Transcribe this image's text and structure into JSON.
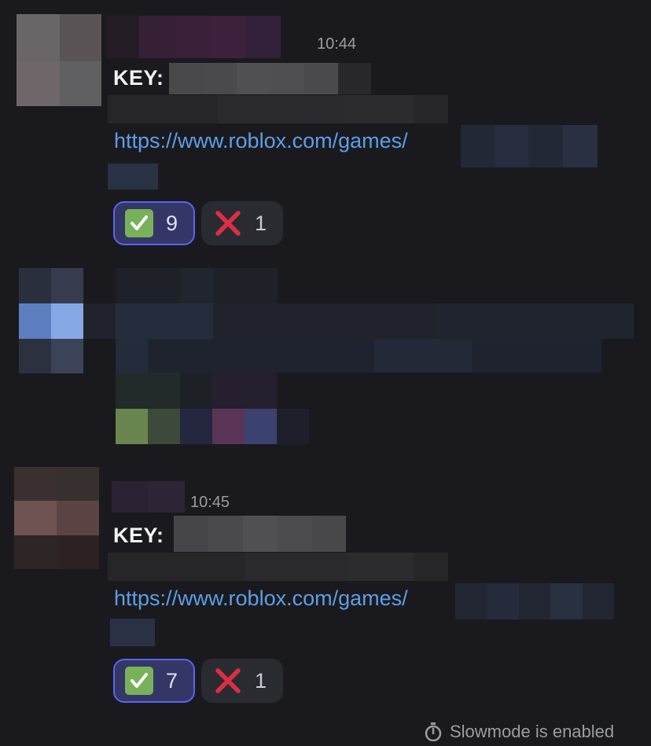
{
  "messages": [
    {
      "timestamp": "10:44",
      "key_label": "KEY:",
      "link_text": "https://www.roblox.com/games/",
      "reactions": [
        {
          "emoji": "check-mark-button",
          "count": "9",
          "active": true
        },
        {
          "emoji": "cross-mark",
          "count": "1",
          "active": false
        }
      ]
    },
    {
      "timestamp": "10:45",
      "key_label": "KEY:",
      "link_text": "https://www.roblox.com/games/",
      "reactions": [
        {
          "emoji": "check-mark-button",
          "count": "7",
          "active": true
        },
        {
          "emoji": "cross-mark",
          "count": "1",
          "active": false
        }
      ]
    }
  ],
  "footer": {
    "slowmode_text": "Slowmode is enabled",
    "slowmode_icon": "stopwatch-icon"
  },
  "colors": {
    "background": "#1a1a1e",
    "link": "#5b9fe8",
    "reaction_active_bg": "#343766",
    "reaction_active_border": "#5865f2",
    "reaction_inactive_bg": "#2a2b30",
    "check_green": "#78b159",
    "cross_red": "#dd2e44"
  }
}
